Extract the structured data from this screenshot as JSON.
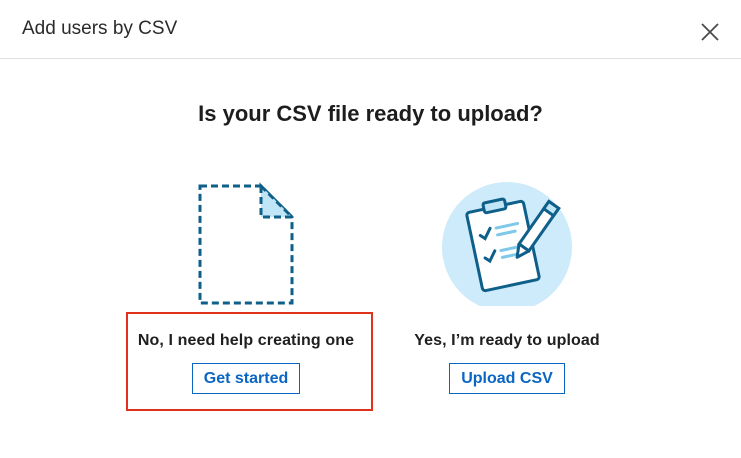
{
  "dialog": {
    "title": "Add users by CSV",
    "close_icon": "close-icon"
  },
  "main": {
    "question": "Is your CSV file ready to upload?",
    "options": [
      {
        "icon": "dashed-document-icon",
        "label": "No, I need help creating one",
        "button_label": "Get started",
        "highlighted": true
      },
      {
        "icon": "clipboard-checklist-icon",
        "label": "Yes, I’m ready to upload",
        "button_label": "Upload CSV"
      }
    ]
  },
  "colors": {
    "accent": "#0a66c2",
    "illustration_dark": "#0e5f8a",
    "illustration_light": "#bfe5f7",
    "highlight": "#e0311c"
  }
}
